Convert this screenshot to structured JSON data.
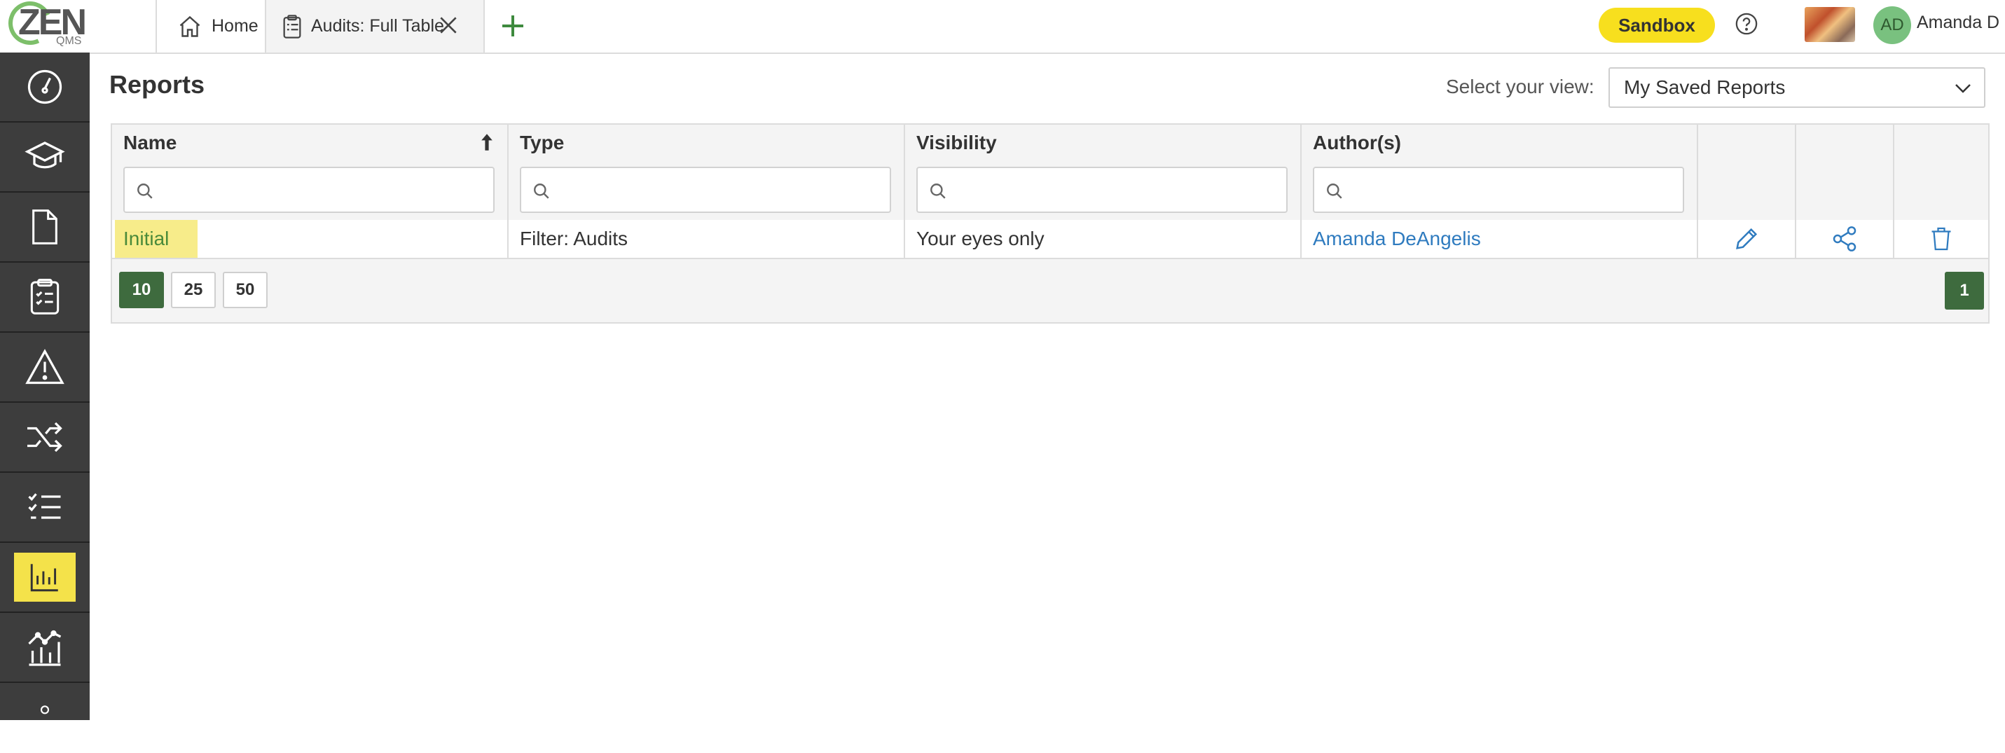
{
  "app": {
    "logo_text": "ZEN",
    "logo_sub": "QMS"
  },
  "tabs": [
    {
      "label": "Home",
      "icon": "home-icon"
    },
    {
      "label": "Audits: Full Table",
      "icon": "clipboard-icon"
    }
  ],
  "header": {
    "sandbox_label": "Sandbox",
    "avatar_initials": "AD",
    "user_name": "Amanda D"
  },
  "sidebar": {
    "items": [
      {
        "icon": "dashboard-icon"
      },
      {
        "icon": "graduation-cap-icon"
      },
      {
        "icon": "document-icon"
      },
      {
        "icon": "clipboard-checklist-icon"
      },
      {
        "icon": "warning-icon"
      },
      {
        "icon": "shuffle-icon"
      },
      {
        "icon": "checklist-icon"
      },
      {
        "icon": "bar-chart-icon",
        "active": true
      },
      {
        "icon": "analytics-icon"
      }
    ]
  },
  "main": {
    "title": "Reports",
    "view_label": "Select your view:",
    "view_value": "My Saved Reports"
  },
  "table": {
    "columns": [
      "Name",
      "Type",
      "Visibility",
      "Author(s)"
    ],
    "rows": [
      {
        "name": "Initial",
        "type": "Filter: Audits",
        "visibility": "Your eyes only",
        "author": "Amanda DeAngelis"
      }
    ],
    "page_sizes": [
      "10",
      "25",
      "50"
    ],
    "selected_page_size": "10",
    "current_page": "1"
  },
  "colors": {
    "accent_green": "#3e6b3e",
    "sandbox_yellow": "#f7df1e",
    "sidebar_bg": "#3d3d3d",
    "link_blue": "#2f7bbf",
    "highlight_yellow": "#f4e24a"
  }
}
